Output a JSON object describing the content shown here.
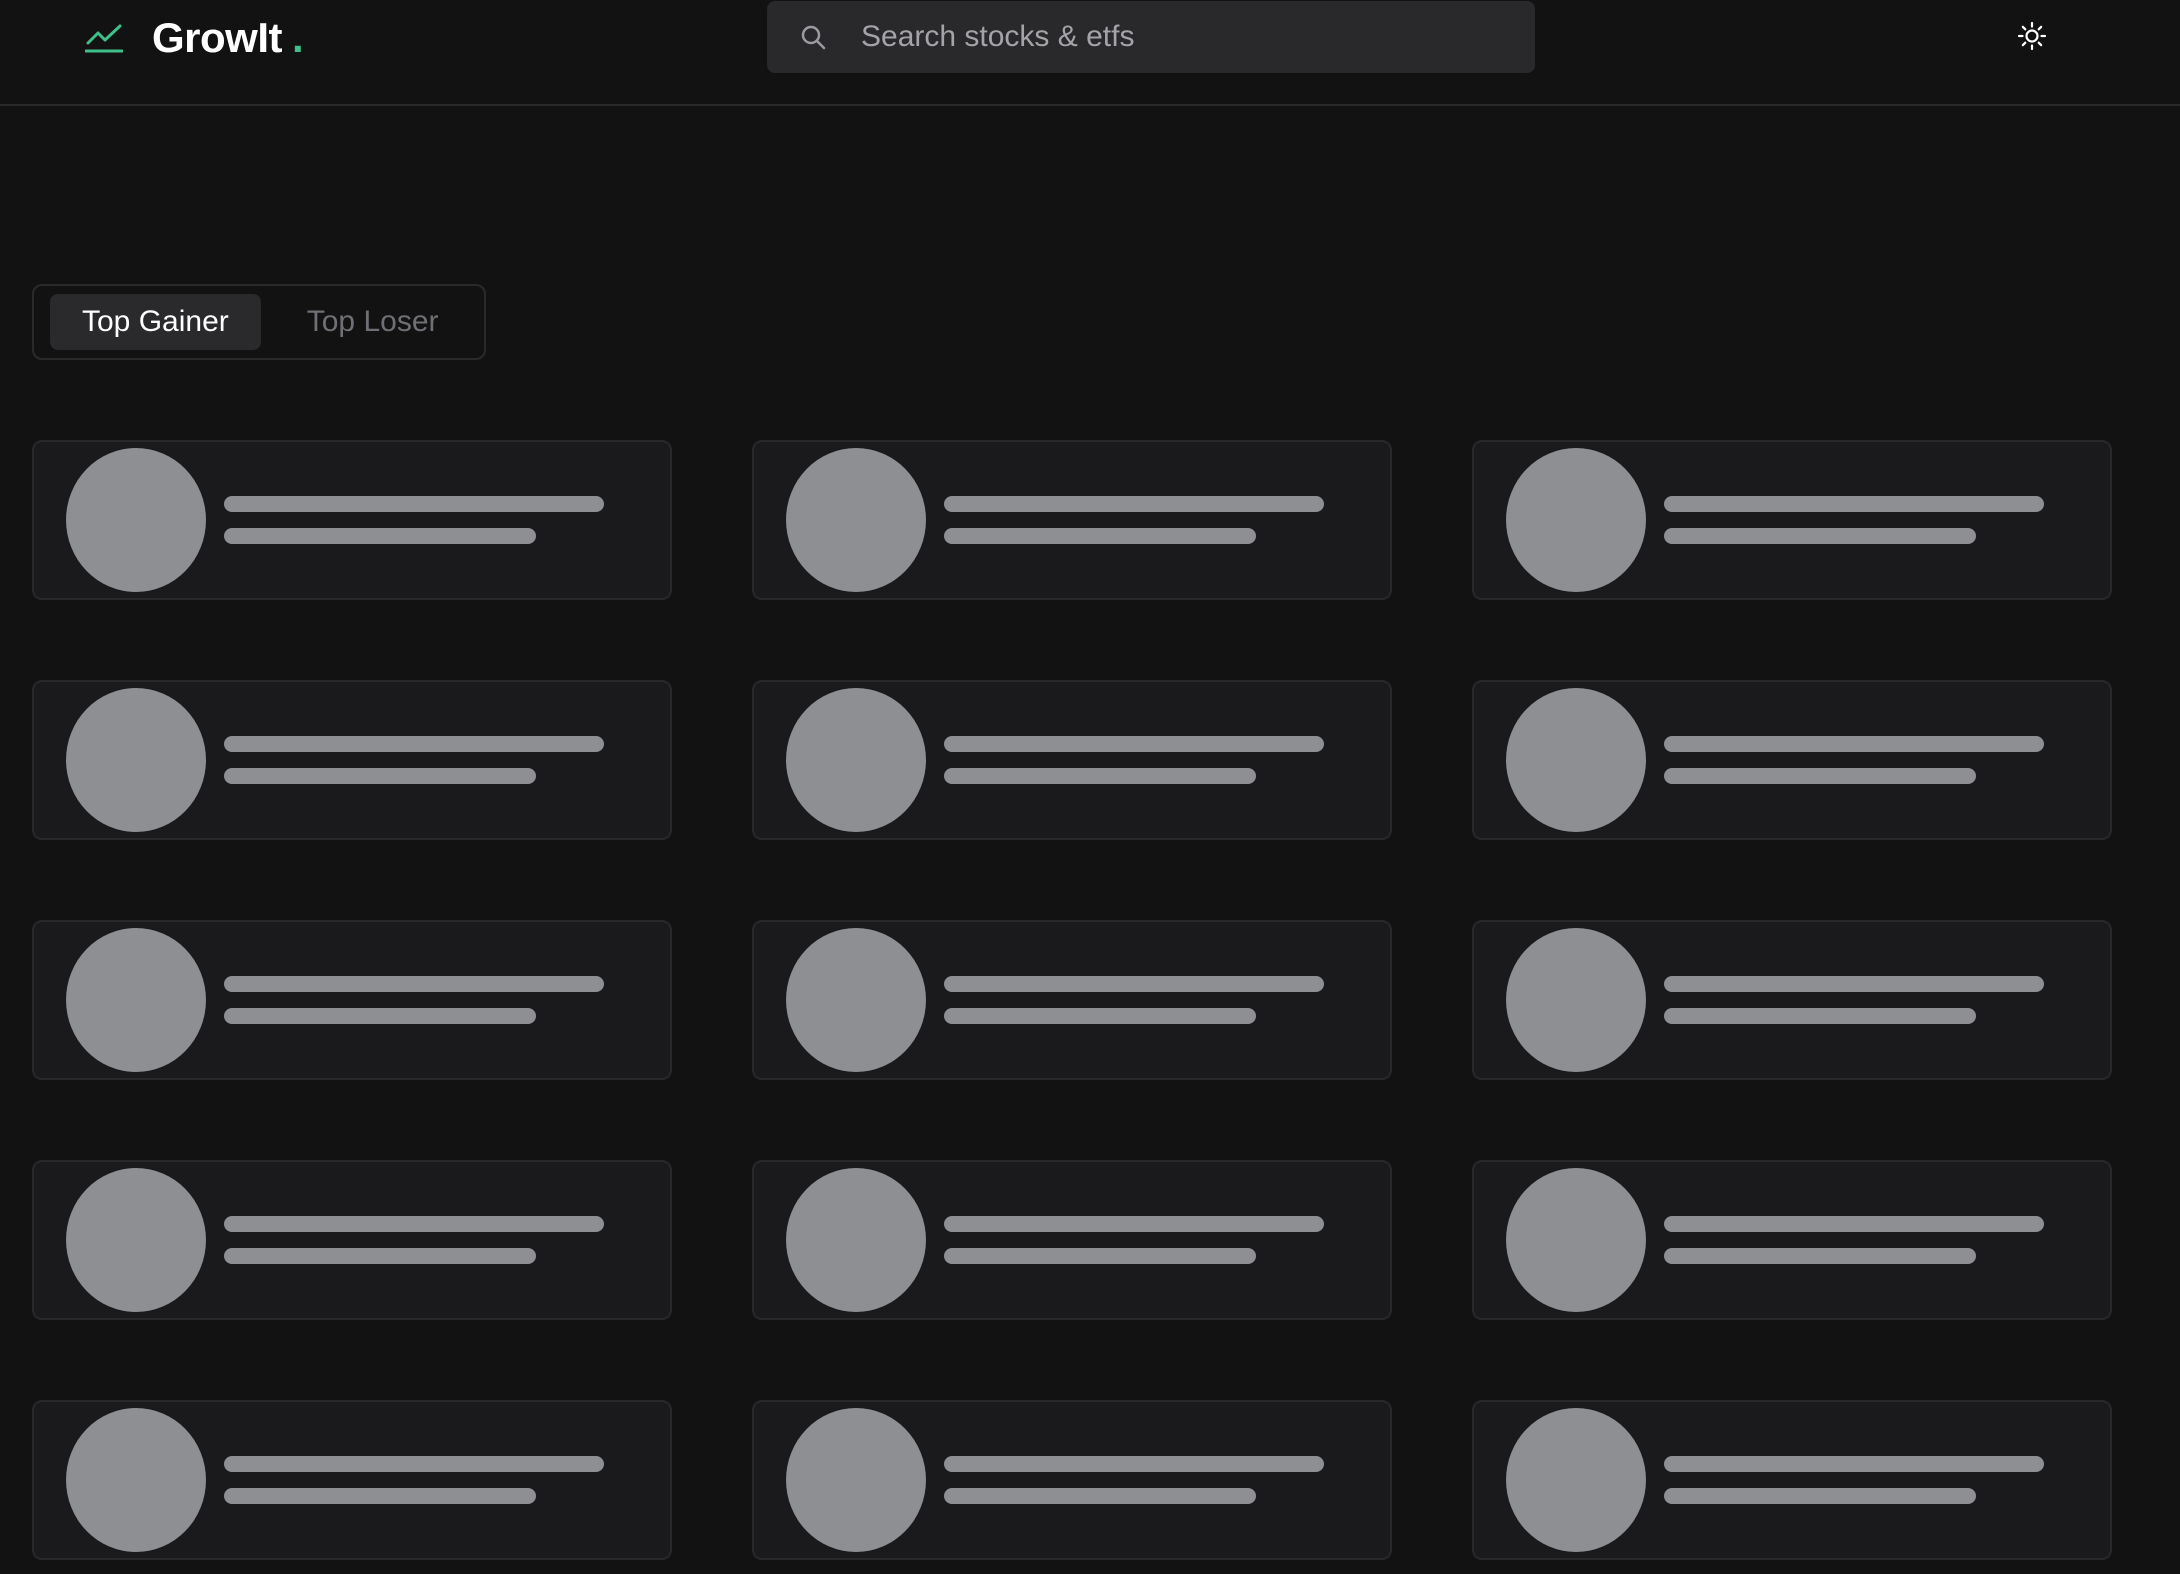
{
  "header": {
    "brand": {
      "name": "GrowIt",
      "dot": ".",
      "icon": "trending-up-icon",
      "accent_color": "#3fbf8a"
    },
    "search": {
      "placeholder": "Search stocks & etfs",
      "value": "",
      "icon": "search-icon"
    },
    "theme_toggle": {
      "icon": "sun-icon"
    }
  },
  "tabs": [
    {
      "label": "Top Gainer",
      "active": true
    },
    {
      "label": "Top Loser",
      "active": false
    }
  ],
  "grid": {
    "state": "loading",
    "skeleton_cards": 15,
    "skeleton_color": "#8e8f93"
  }
}
